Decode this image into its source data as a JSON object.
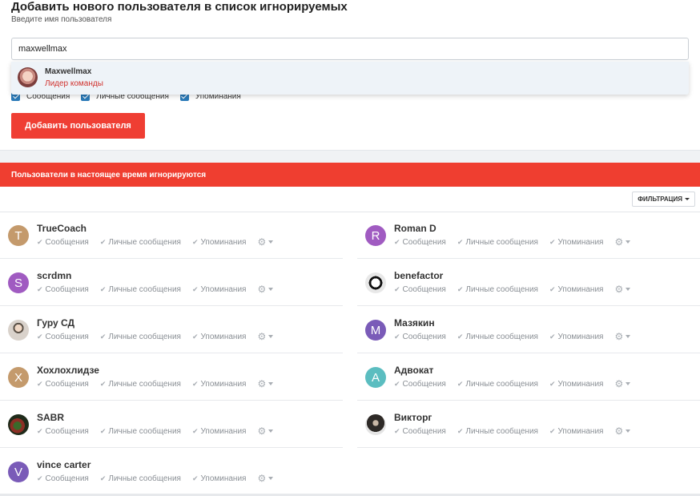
{
  "form": {
    "title": "Добавить нового пользователя в список игнорируемых",
    "subtitle": "Введите имя пользователя",
    "input_value": "maxwellmax",
    "checkboxes": [
      "Сообщения",
      "Личные сообщения",
      "Упоминания"
    ],
    "add_button": "Добавить пользователя"
  },
  "suggestion": {
    "name": "Maxwellmax",
    "role": "Лидер команды"
  },
  "ignored": {
    "header": "Пользователи в настоящее время игнорируются",
    "filter_label": "ФИЛЬТРАЦИЯ",
    "pref_labels": [
      "Сообщения",
      "Личные сообщения",
      "Упоминания"
    ],
    "users": [
      {
        "name": "TrueCoach",
        "initial": "T",
        "color": "#c49a6c"
      },
      {
        "name": "Roman D",
        "initial": "R",
        "color": "#a05bc1"
      },
      {
        "name": "scrdmn",
        "initial": "S",
        "color": "#a05bc1"
      },
      {
        "name": "benefactor",
        "initial": "",
        "color": "#222222"
      },
      {
        "name": "Гуру СД",
        "initial": "",
        "color": "#d9d2cb"
      },
      {
        "name": "Мазякин",
        "initial": "M",
        "color": "#7a5bb8"
      },
      {
        "name": "Хохлохлидзе",
        "initial": "X",
        "color": "#c49a6c"
      },
      {
        "name": "Адвокат",
        "initial": "A",
        "color": "#5bbdc0"
      },
      {
        "name": "SABR",
        "initial": "",
        "color": "#2a3a22"
      },
      {
        "name": "Викторг",
        "initial": "",
        "color": "#2e2a27"
      },
      {
        "name": "vince carter",
        "initial": "V",
        "color": "#7a5bb8"
      }
    ]
  },
  "colors": {
    "accent_red": "#ef3e30",
    "checkbox_blue": "#2a7ab8"
  },
  "icons": {
    "check": "check-icon",
    "settings": "gear-icon",
    "dropdown": "caret-down-icon"
  }
}
